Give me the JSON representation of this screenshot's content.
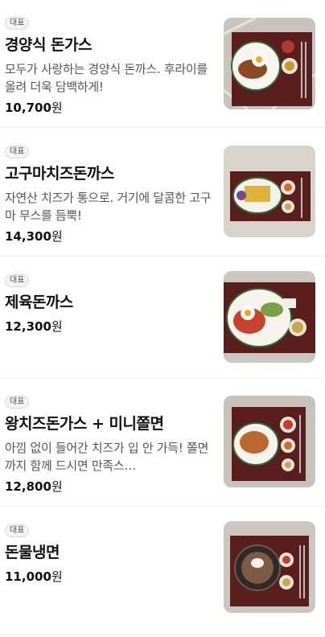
{
  "menu": {
    "items": [
      {
        "badge": "대표",
        "name": "경양식 돈가스",
        "description": "모두가 사랑하는 경양식 돈까스. 후라이를 올려 더욱 담백하게!",
        "price": "10,700",
        "currency": "원",
        "photo": "plate-cutlet-egg"
      },
      {
        "badge": "대표",
        "name": "고구마치즈돈까스",
        "description": "자연산 치즈가 통으로. 거기에 달콤한 고구마 무스를 듬뿍!",
        "price": "14,300",
        "currency": "원",
        "photo": "plate-cheese-cutlet"
      },
      {
        "badge": "대표",
        "name": "제육돈까스",
        "description": "",
        "price": "12,300",
        "currency": "원",
        "photo": "plate-pork-cutlet"
      },
      {
        "badge": "대표",
        "name": "왕치즈돈가스 + 미니쫄면",
        "description": "아낌 없이 들어간 치즈가 입 안 가득! 쫄면까지 함께 드시면 만족스…",
        "price": "12,800",
        "currency": "원",
        "photo": "plate-cutlet-jjolmyeon"
      },
      {
        "badge": "대표",
        "name": "돈물냉면",
        "description": "",
        "price": "11,000",
        "currency": "원",
        "photo": "tray-naengmyeon"
      }
    ]
  }
}
